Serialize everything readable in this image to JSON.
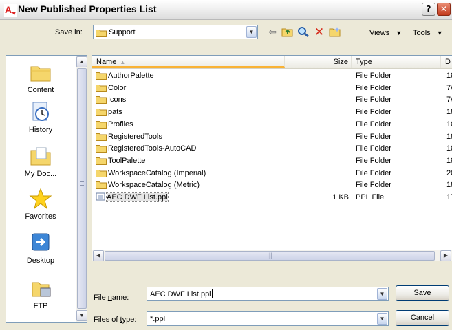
{
  "window": {
    "title": "New Published Properties List",
    "help_label": "?",
    "close_label": "✕"
  },
  "toolbar": {
    "save_in_label": "Save in:",
    "save_in_value": "Support",
    "views_label": "Views",
    "tools_label": "Tools"
  },
  "places": [
    {
      "label": "Content",
      "icon": "content-folder-icon"
    },
    {
      "label": "History",
      "icon": "history-icon"
    },
    {
      "label": "My Doc...",
      "icon": "my-documents-icon"
    },
    {
      "label": "Favorites",
      "icon": "favorites-star-icon"
    },
    {
      "label": "Desktop",
      "icon": "desktop-icon"
    },
    {
      "label": "FTP",
      "icon": "ftp-icon"
    }
  ],
  "columns": {
    "name": "Name",
    "size": "Size",
    "type": "Type",
    "date": "D"
  },
  "files": [
    {
      "name": "AuthorPalette",
      "size": "",
      "type": "File Folder",
      "date": "18"
    },
    {
      "name": "Color",
      "size": "",
      "type": "File Folder",
      "date": "7/"
    },
    {
      "name": "Icons",
      "size": "",
      "type": "File Folder",
      "date": "7/"
    },
    {
      "name": "pats",
      "size": "",
      "type": "File Folder",
      "date": "18"
    },
    {
      "name": "Profiles",
      "size": "",
      "type": "File Folder",
      "date": "18"
    },
    {
      "name": "RegisteredTools",
      "size": "",
      "type": "File Folder",
      "date": "19"
    },
    {
      "name": "RegisteredTools-AutoCAD",
      "size": "",
      "type": "File Folder",
      "date": "18"
    },
    {
      "name": "ToolPalette",
      "size": "",
      "type": "File Folder",
      "date": "18"
    },
    {
      "name": "WorkspaceCatalog (Imperial)",
      "size": "",
      "type": "File Folder",
      "date": "20"
    },
    {
      "name": "WorkspaceCatalog (Metric)",
      "size": "",
      "type": "File Folder",
      "date": "18"
    },
    {
      "name": "AEC DWF List.ppl",
      "size": "1 KB",
      "type": "PPL File",
      "date": "17"
    }
  ],
  "footer": {
    "file_name_label": "File name:",
    "file_name_value": "AEC DWF List.ppl",
    "file_type_label": "Files of type:",
    "file_type_value": "*.ppl",
    "save_label": "Save",
    "cancel_label": "Cancel"
  },
  "colors": {
    "folder": "#f5d66b",
    "close_button": "#c33a1d",
    "sort_highlight": "#f9b234",
    "border": "#7f9db9"
  }
}
